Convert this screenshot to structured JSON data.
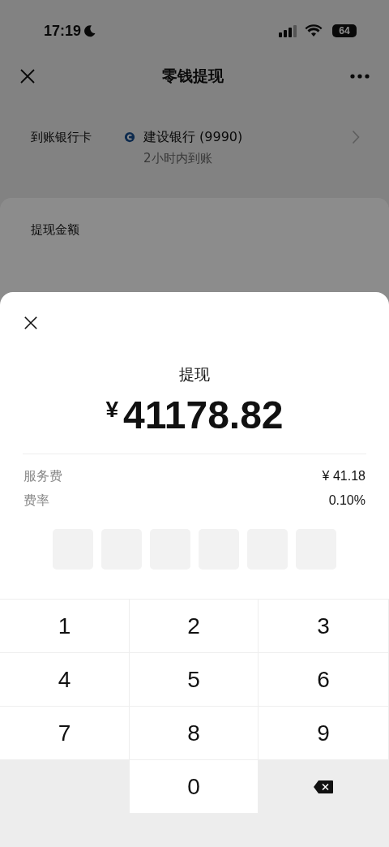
{
  "status_bar": {
    "time": "17:19",
    "battery": "64"
  },
  "nav": {
    "title": "零钱提现"
  },
  "bank": {
    "label": "到账银行卡",
    "card": "建设银行 (9990)",
    "arrival": "2小时内到账"
  },
  "amount_card": {
    "label": "提现金额"
  },
  "sheet": {
    "title": "提现",
    "currency": "¥",
    "amount": "41178.82",
    "details": [
      {
        "label": "服务费",
        "value": "¥ 41.18"
      },
      {
        "label": "费率",
        "value": "0.10%"
      }
    ],
    "pin": [
      {
        "filled": false
      },
      {
        "filled": false
      },
      {
        "filled": false
      },
      {
        "filled": false
      },
      {
        "filled": false
      },
      {
        "filled": false
      }
    ],
    "keys": [
      {
        "kind": "digit",
        "label": "1"
      },
      {
        "kind": "digit",
        "label": "2"
      },
      {
        "kind": "digit",
        "label": "3"
      },
      {
        "kind": "digit",
        "label": "4"
      },
      {
        "kind": "digit",
        "label": "5"
      },
      {
        "kind": "digit",
        "label": "6"
      },
      {
        "kind": "digit",
        "label": "7"
      },
      {
        "kind": "digit",
        "label": "8"
      },
      {
        "kind": "digit",
        "label": "9"
      },
      {
        "kind": "blank"
      },
      {
        "kind": "digit",
        "label": "0"
      },
      {
        "kind": "delete"
      }
    ]
  }
}
